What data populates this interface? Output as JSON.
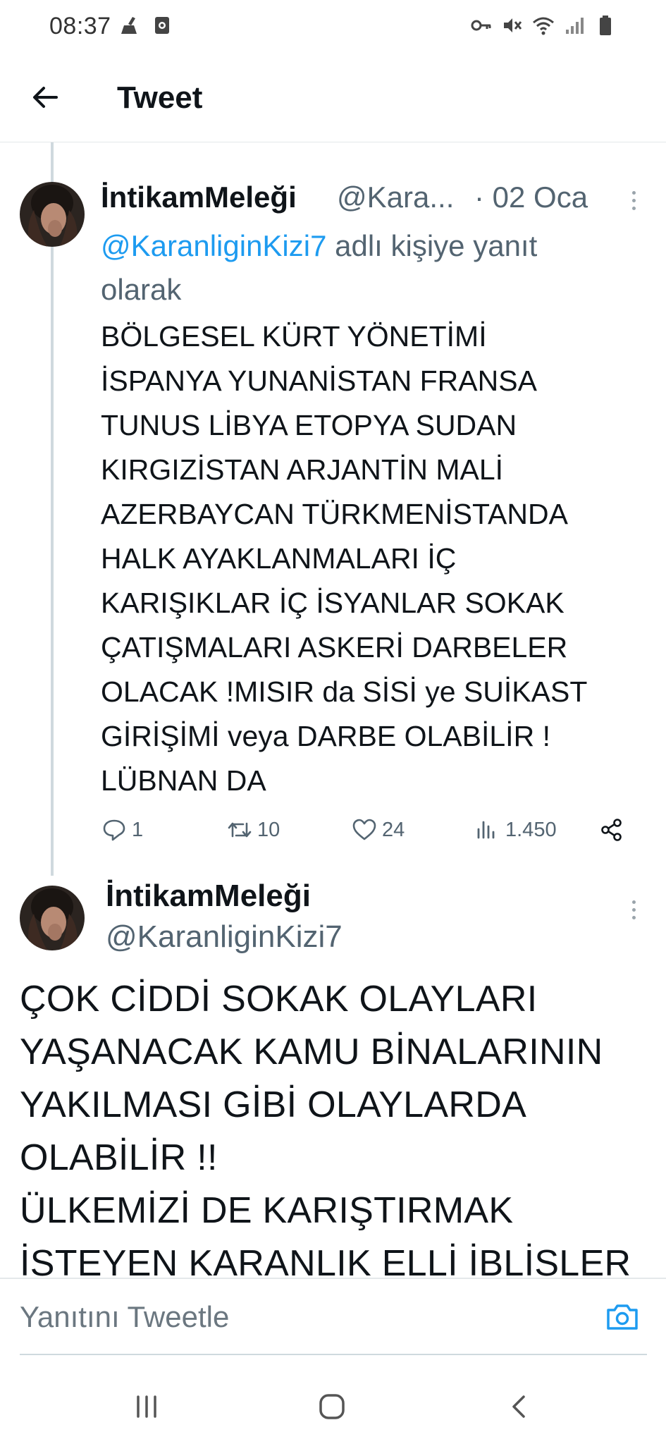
{
  "status_bar": {
    "time": "08:37",
    "left_icons": [
      "broom-icon",
      "screen-record-icon"
    ],
    "right_icons": [
      "key-icon",
      "mute-icon",
      "wifi-icon",
      "signal-icon",
      "battery-icon"
    ]
  },
  "header": {
    "back_icon": "arrow-left-icon",
    "title": "Tweet"
  },
  "tweet1": {
    "name": "İntikamMeleği",
    "handle": "@Kara...",
    "date": "· 02 Oca",
    "reply_mention": "@KaranliginKizi7",
    "reply_suffix": " adlı kişiye yanıt olarak",
    "body": "BÖLGESEL KÜRT YÖNETİMİ\nİSPANYA YUNANİSTAN FRANSA\nTUNUS LİBYA ETOPYA SUDAN\nKIRGIZİSTAN ARJANTİN MALİ\nAZERBAYCAN TÜRKMENİSTANDA\nHALK AYAKLANMALARI İÇ\nKARIŞIKLAR İÇ İSYANLAR SOKAK\nÇATIŞMALARI ASKERİ DARBELER\nOLACAK !MISIR da SİSİ ye SUİKAST\nGİRİŞİMİ veya DARBE OLABİLİR !\nLÜBNAN DA",
    "actions": {
      "replies": "1",
      "retweets": "10",
      "likes": "24",
      "views": "1.450"
    }
  },
  "tweet2": {
    "name": "İntikamMeleği",
    "handle": "@KaranliginKizi7",
    "body": "ÇOK CİDDİ SOKAK OLAYLARI\nYAŞANACAK KAMU BİNALARININ\nYAKILMASI GİBİ OLAYLARDA\nOLABİLİR !!\nÜLKEMİZİ DE KARIŞTIRMAK\nİSTEYEN KARANLIK ELLİ İBLİSLER"
  },
  "reply_bar": {
    "placeholder": "Yanıtını Tweetle",
    "camera_icon": "camera-icon"
  },
  "nav_bar": {
    "icons": [
      "recents-icon",
      "home-icon",
      "back-icon"
    ]
  },
  "colors": {
    "accent": "#1d9bf0",
    "secondary_text": "#536471",
    "primary_text": "#0f1419",
    "thread_line": "#cfd9de"
  }
}
